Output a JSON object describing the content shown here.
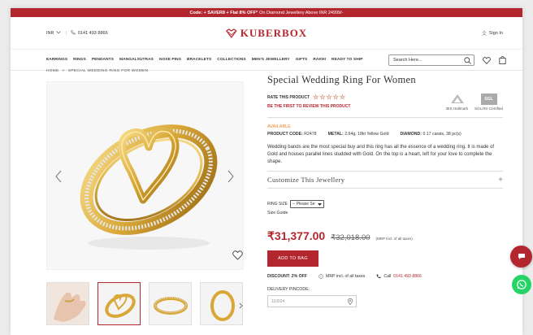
{
  "promo": {
    "bold": "Code: + SAVER8 + Flat 8% OFF*",
    "rest": "On Diamond Jewellery Above INR 24999/-"
  },
  "topbar": {
    "currency": "INR",
    "phone": "0141 493 8866",
    "brand": "KUBERBOX",
    "signin": "Sign In"
  },
  "nav": {
    "items": [
      "EARRINGS",
      "RINGS",
      "PENDANTS",
      "MANGALSUTRAS",
      "NOSE PINS",
      "BRACELETS",
      "COLLECTIONS",
      "MEN'S JEWELLERY",
      "GIFTS",
      "RAKHI",
      "READY TO SHIP"
    ],
    "search_placeholder": "Search Here..."
  },
  "breadcrumb": {
    "home": "HOME",
    "sep": ">",
    "current": "SPECIAL WEDDING RING FOR WOMEN"
  },
  "product": {
    "title": "Special Wedding Ring For Women",
    "rate_label": "RATE THIS PRODUCT",
    "stars": "☆☆☆☆☆",
    "review_prompt": "BE THE FIRST TO REVIEW THIS PRODUCT",
    "cert1": "BIS Hallmark",
    "cert2": "SGL/IGI Certified",
    "cert2_badge": "SGL",
    "availability": "AVAILABLE",
    "code_label": "PRODUCT CODE:",
    "code_value": "R2478",
    "metal_label": "METAL:",
    "metal_value": "2.64g, 18kt Yellow Gold",
    "diamond_label": "DIAMOND:",
    "diamond_value": "0.17 carats, 38 pc(s)",
    "description": "Wedding bands are the most special buy and this ring has all the essence of a wedding ring. It is made of Gold and houses parallel lines studded with Gold. On the top is a heart, left for your love to complete the shape.",
    "customize": "Customize This Jewellery",
    "plus": "+",
    "ring_size_label": "RING SIZE",
    "ring_size_select": "-- Please Se",
    "size_guide": "Size Guide",
    "price": "₹31,377.00",
    "mrp": "₹32,018.00",
    "mrp_note": "(MRP Incl. of all taxes)",
    "add_to_bag": "ADD TO BAG",
    "discount": "DISCOUNT: 2% OFF",
    "mrp_incl": "MRP incl. of all taxes",
    "call_label": "Call",
    "call_number": "0141 493 8866",
    "pincode_label": "DELIVERY PINCODE:",
    "pincode_placeholder": "110024"
  },
  "colors": {
    "brand": "#b3262e",
    "available": "#e8842b",
    "whatsapp": "#25d366"
  }
}
